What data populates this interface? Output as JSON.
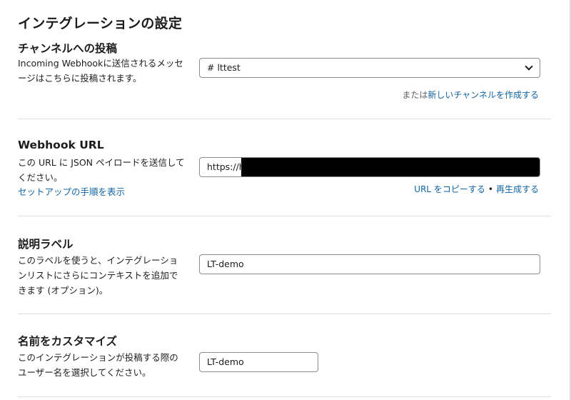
{
  "page": {
    "title": "インテグレーションの設定"
  },
  "channel": {
    "title": "チャンネルへの投稿",
    "description": "Incoming Webhookに送信されるメッセージはこちらに投稿されます。",
    "selected": "# lttest",
    "create_prefix": "または",
    "create_link": "新しいチャンネルを作成する"
  },
  "webhook": {
    "title": "Webhook URL",
    "description": "この URL に JSON ペイロードを送信してください。",
    "setup_link": "セットアップの手順を表示",
    "url_value": "https://h",
    "copy_link": "URL をコピーする",
    "separator": "•",
    "regenerate_link": "再生成する"
  },
  "label": {
    "title": "説明ラベル",
    "description": "このラベルを使うと、インテグレーションリストにさらにコンテキストを追加できます (オプション)。",
    "value": "LT-demo"
  },
  "name": {
    "title": "名前をカスタマイズ",
    "description": "このインテグレーションが投稿する際のユーザー名を選択してください。",
    "value": "LT-demo"
  }
}
